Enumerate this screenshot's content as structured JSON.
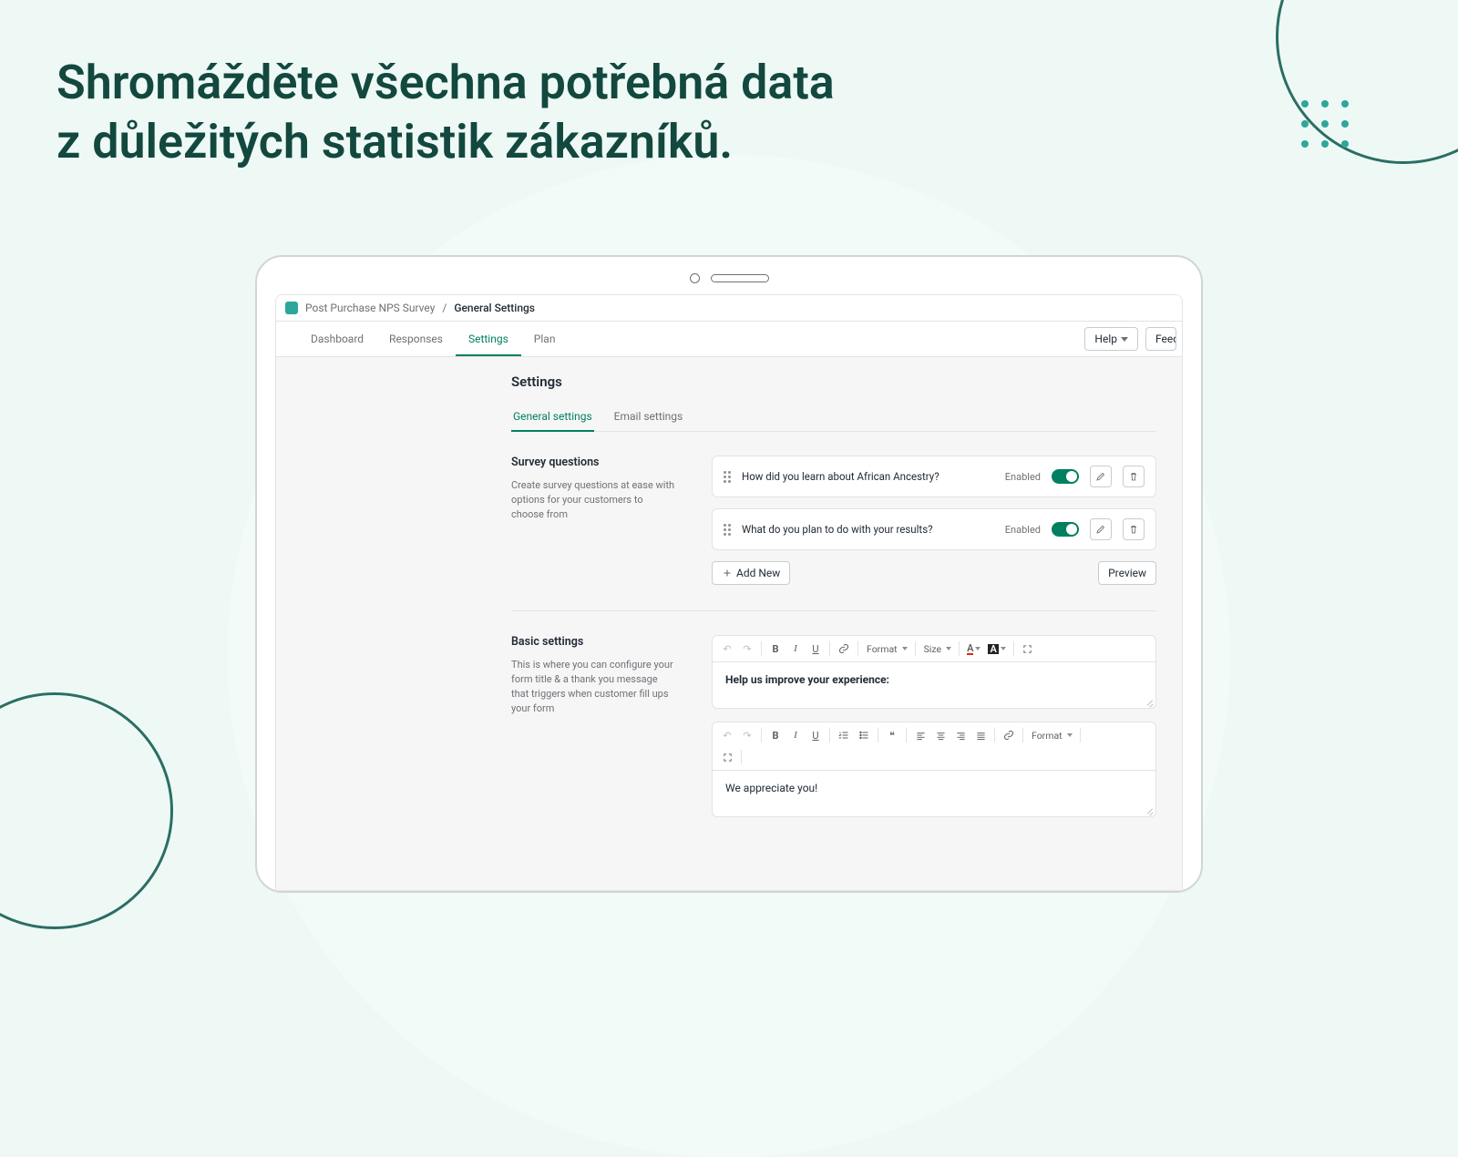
{
  "hero": {
    "line1": "Shromážděte všechna potřebná data",
    "line2": "z důležitých statistik zákazníků."
  },
  "breadcrumb": {
    "root": "Post Purchase NPS Survey",
    "sep": " / ",
    "current": "General Settings"
  },
  "main_tabs": {
    "dashboard": "Dashboard",
    "responses": "Responses",
    "settings": "Settings",
    "plan": "Plan"
  },
  "header_buttons": {
    "help": "Help",
    "feedback": "Feedback"
  },
  "page": {
    "title": "Settings"
  },
  "sub_tabs": {
    "general": "General settings",
    "email": "Email settings"
  },
  "survey_section": {
    "title": "Survey questions",
    "desc": "Create survey questions at ease with options for your customers to choose from",
    "questions": [
      {
        "text": "How did you learn about African Ancestry?",
        "status": "Enabled"
      },
      {
        "text": "What do you plan to do with your results?",
        "status": "Enabled"
      }
    ],
    "add_label": "Add New",
    "preview_label": "Preview"
  },
  "basic_section": {
    "title": "Basic settings",
    "desc": "This is where you can configure your form title & a thank you message that triggers when customer fill ups your form",
    "editor1_text": "Help us improve your experience:",
    "editor2_text": "We appreciate you!"
  },
  "rte": {
    "format": "Format",
    "size": "Size"
  }
}
